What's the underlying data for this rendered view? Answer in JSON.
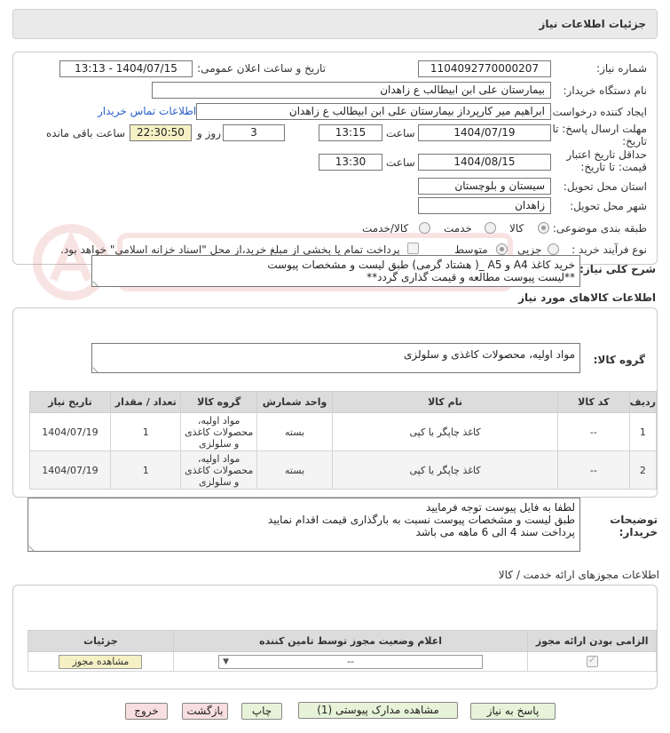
{
  "header": {
    "title": "جزئیات اطلاعات نیاز"
  },
  "fields": {
    "need_number_label": "شماره نیاز:",
    "need_number": "1104092770000207",
    "announce_label": "تاریخ و ساعت اعلان عمومی:",
    "announce_value": "1404/07/15 - 13:13",
    "buyer_org_label": "نام دستگاه خریدار:",
    "buyer_org": "بیمارستان علی ابن ابیطالب  ع  زاهدان",
    "requester_label": "ایجاد کننده درخواست:",
    "requester": "ابراهیم میر کارپرداز بیمارستان علی ابن ابیطالب  ع  زاهدان",
    "contact_link": "اطلاعات تماس خریدار",
    "reply_deadline_label_1": "مهلت ارسال پاسخ: تا",
    "reply_deadline_label_2": "تاریخ:",
    "reply_date": "1404/07/19",
    "time_label": "ساعت",
    "reply_time": "13:15",
    "days_value": "3",
    "days_label": "روز و",
    "remaining_time": "22:30:50",
    "remaining_label": "ساعت باقی مانده",
    "validity_label_1": "حداقل تاریخ اعتبار",
    "validity_label_2": "قیمت: تا تاریخ:",
    "validity_date": "1404/08/15",
    "validity_time": "13:30",
    "province_label": "استان محل تحویل:",
    "province": "سیستان و بلوچستان",
    "city_label": "شهر محل تحویل:",
    "city": "زاهدان",
    "category_label": "طبقه بندی موضوعی:",
    "category_options": [
      "کالا",
      "خدمت",
      "کالا/خدمت"
    ],
    "process_label": "نوع فرآیند خرید :",
    "process_options": [
      "جزیی",
      "متوسط"
    ],
    "payment_note": "پرداخت تمام یا بخشی از مبلغ خرید،از محل \"اسناد خزانه اسلامی\" خواهد بود."
  },
  "description": {
    "label": "شرح کلی نیاز:",
    "line1": "خرید کاغذ A4 و A5 _( هشتاد گرمی) طبق لیست و مشخصات پیوست",
    "line2": "**لیست پیوست مطالعه و قیمت گذاری گردد**"
  },
  "goods_section_title": "اطلاعات کالاهای مورد نیاز",
  "goods_group": {
    "label": "گروه کالا:",
    "value": "مواد اولیه، محصولات کاغذی و سلولزی"
  },
  "table": {
    "headers": [
      "ردیف",
      "کد کالا",
      "نام کالا",
      "واحد شمارش",
      "گروه کالا",
      "تعداد / مقدار",
      "تاریخ نیاز"
    ],
    "rows": [
      {
        "row": "1",
        "code": "--",
        "name": "کاغذ چاپگر یا کپی",
        "unit": "بسته",
        "group": "مواد اولیه، محصولات کاغذی و سلولزی",
        "qty": "1",
        "date": "1404/07/19"
      },
      {
        "row": "2",
        "code": "--",
        "name": "کاغذ چاپگر یا کپی",
        "unit": "بسته",
        "group": "مواد اولیه، محصولات کاغذی و سلولزی",
        "qty": "1",
        "date": "1404/07/19"
      }
    ]
  },
  "buyer_notes": {
    "label_1": "توضیحات",
    "label_2": "خریدار:",
    "line1": "لطفا به فایل پیوست توجه فرمایید",
    "line2": "طبق لیست و مشخصات پیوست نسبت به بارگذاری قیمت اقدام نمایید",
    "line3": "پرداخت سند 4 الی 6 ماهه می باشد"
  },
  "permits": {
    "title": "اطلاعات مجوزهای ارائه خدمت / کالا",
    "headers": [
      "الزامی بودن ارائه مجوز",
      "اعلام وضعیت مجوز توسط تامین کننده",
      "جزئیات"
    ],
    "select_value": "--",
    "view_button": "مشاهده مجوز"
  },
  "actions": {
    "reply": "پاسخ به نیاز",
    "attachments": "مشاهده مدارک پیوستی (1)",
    "print": "چاپ",
    "back": "بازگشت",
    "exit": "خروج"
  },
  "colors": {
    "title_bg": "#eaeaea",
    "yellow_box": "#f5f1c4",
    "green_button": "#e6f3d8",
    "red_button": "#f8dede",
    "link": "#2a62c7"
  }
}
